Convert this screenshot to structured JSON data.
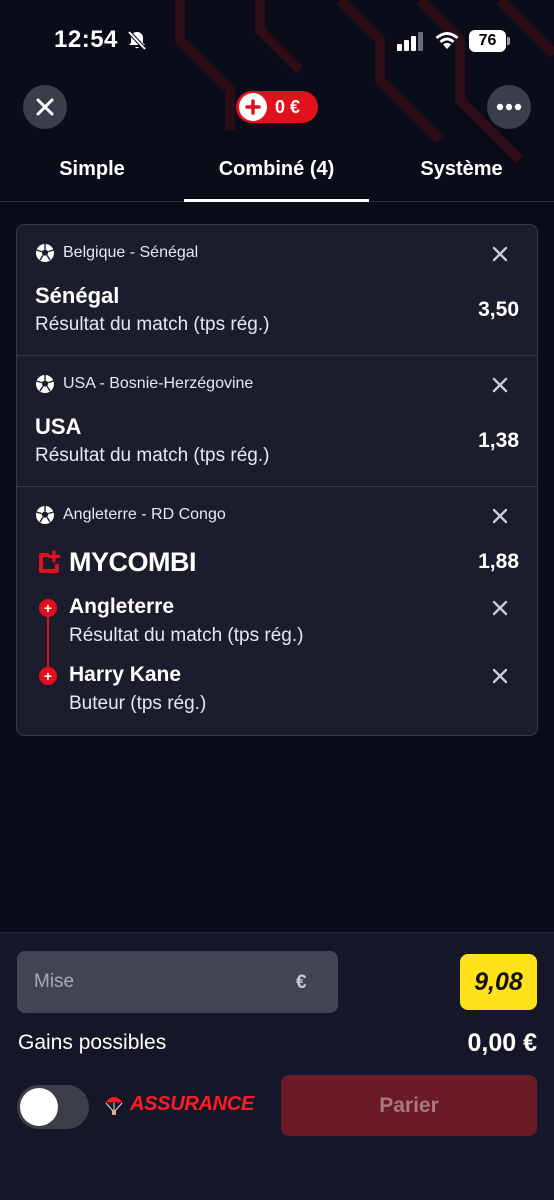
{
  "status_bar": {
    "time": "12:54",
    "battery": "76"
  },
  "header": {
    "balance": "0 €"
  },
  "tabs": [
    {
      "label": "Simple"
    },
    {
      "label": "Combiné (4)"
    },
    {
      "label": "Système"
    }
  ],
  "bets": [
    {
      "match": "Belgique - Sénégal",
      "selection": "Sénégal",
      "market": "Résultat du match (tps rég.)",
      "odds": "3,50"
    },
    {
      "match": "USA - Bosnie-Herzégovine",
      "selection": "USA",
      "market": "Résultat du match (tps rég.)",
      "odds": "1,38"
    },
    {
      "match": "Angleterre - RD Congo",
      "combi_label": "MYCOMBI",
      "odds": "1,88",
      "legs": [
        {
          "selection": "Angleterre",
          "market": "Résultat du match (tps rég.)"
        },
        {
          "selection": "Harry Kane",
          "market": "Buteur (tps rég.)"
        }
      ]
    }
  ],
  "bottom": {
    "stake_placeholder": "Mise",
    "currency": "€",
    "total_odds": "9,08",
    "gains_label": "Gains possibles",
    "gains_value": "0,00 €",
    "assurance_label": "ASSURANCE",
    "submit_label": "Parier"
  },
  "colors": {
    "background": "#0b0c1a",
    "brand_red": "#e0101c",
    "odds_yellow": "#ffe21a",
    "card": "#1b1d2d"
  }
}
